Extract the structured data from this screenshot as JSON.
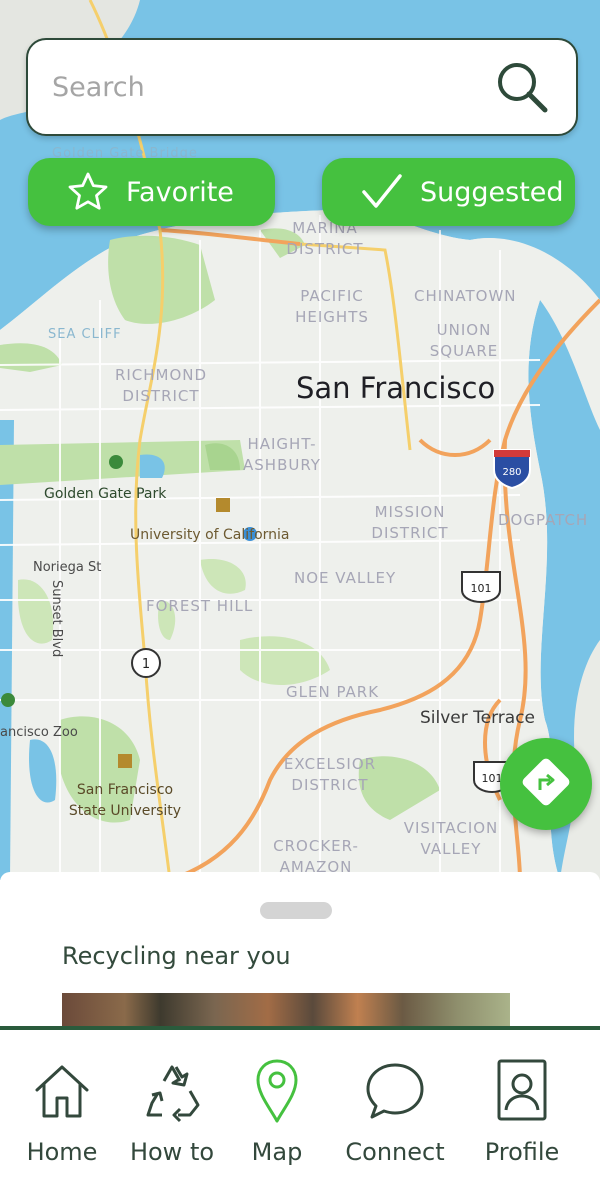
{
  "search": {
    "placeholder": "Search",
    "icon": "search-icon"
  },
  "filters": [
    {
      "label": "Favorite",
      "icon": "star-icon"
    },
    {
      "label": "Suggested",
      "icon": "checkmark-icon"
    }
  ],
  "map": {
    "city": "San Francisco",
    "districts": [
      "MARINA DISTRICT",
      "PACIFIC HEIGHTS",
      "CHINATOWN",
      "UNION SQUARE",
      "SEA CLIFF",
      "RICHMOND DISTRICT",
      "HAIGHT-ASHBURY",
      "MISSION DISTRICT",
      "DOGPATCH",
      "NOE VALLEY",
      "FOREST HILL",
      "GLEN PARK",
      "EXCELSIOR DISTRICT",
      "VISITACION VALLEY",
      "CROCKER-AMAZON"
    ],
    "places": [
      "Golden Gate Bridge",
      "Golden Gate Park",
      "University of California",
      "Noriega St",
      "Sunset Blvd",
      "ancisco Zoo",
      "San Francisco State University",
      "Silver Terrace"
    ],
    "route_shields": [
      "280",
      "101",
      "1",
      "101"
    ],
    "accent_color": "#45c13f"
  },
  "directions_button": {
    "icon": "directions-icon"
  },
  "sheet": {
    "title": "Recycling near you"
  },
  "tabs": [
    {
      "label": "Home",
      "icon": "home-icon"
    },
    {
      "label": "How to",
      "icon": "recycle-icon"
    },
    {
      "label": "Map",
      "icon": "map-pin-icon",
      "active": true
    },
    {
      "label": "Connect",
      "icon": "chat-bubble-icon"
    },
    {
      "label": "Profile",
      "icon": "profile-card-icon"
    }
  ],
  "colors": {
    "primary_green": "#45c13f",
    "dark_green": "#2a5b3c",
    "text_dark": "#33483c",
    "water": "#79c3e6",
    "park": "#bfe0a9",
    "highway": "#f2a35c"
  }
}
